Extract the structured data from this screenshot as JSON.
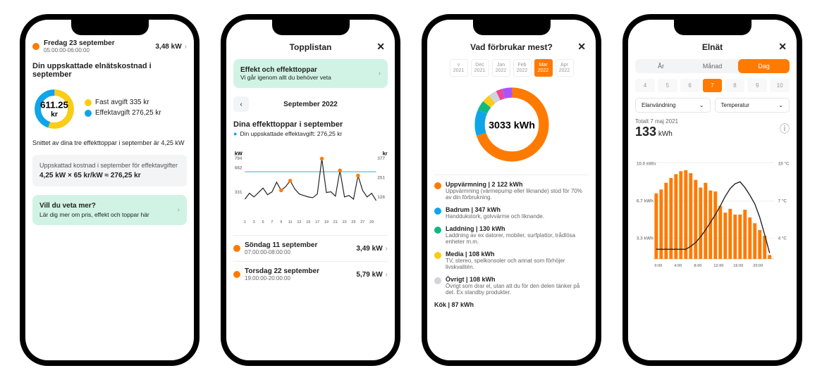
{
  "phone1": {
    "header_title": "Fredag 23 september",
    "header_time": "05:00:00-06:00:00",
    "header_value": "3,48 kW",
    "cost_title": "Din uppskattade elnätskostnad i september",
    "donut_value": "611.25",
    "donut_unit": "kr",
    "cost_items": [
      {
        "dot": "#facc15",
        "text": "Fast avgift 335 kr"
      },
      {
        "dot": "#0ea5e9",
        "text": "Effektavgift 276,25 kr"
      }
    ],
    "avg_text": "Snittet av dina tre effekttoppar i september är 4,25 kW",
    "calc_title": "Uppskattad kostnad i september för effektavgifter",
    "calc_line": "4,25 kW × 65 kr/kW ≈ 276,25 kr",
    "more_title": "Vill du veta mer?",
    "more_sub": "Lär dig mer om pris, effekt och toppar här"
  },
  "phone2": {
    "title": "Topplistan",
    "banner_title": "Effekt och effekttoppar",
    "banner_sub": "Vi går igenom allt du behöver veta",
    "month_label": "September 2022",
    "section_title": "Dina effekttoppar i september",
    "section_sub": "Din uppskattade effektavgift: 276,25 kr",
    "axis_kw": "kW",
    "axis_kr": "kr",
    "peaks": [
      {
        "title": "Söndag 11 september",
        "time": "07:00:00-08:00:00",
        "value": "3,49 kW"
      },
      {
        "title": "Torsdag 22 september",
        "time": "19:00:00-20:00:00",
        "value": "5,79 kW"
      }
    ]
  },
  "phone3": {
    "title": "Vad förbrukar mest?",
    "months": [
      {
        "m": "v",
        "y": "2021",
        "active": false
      },
      {
        "m": "Dec",
        "y": "2021",
        "active": false
      },
      {
        "m": "Jan",
        "y": "2022",
        "active": false
      },
      {
        "m": "Feb",
        "y": "2022",
        "active": false
      },
      {
        "m": "Mar",
        "y": "2022",
        "active": true
      },
      {
        "m": "Apr",
        "y": "2022",
        "active": false
      }
    ],
    "total": "3033 kWh",
    "categories": [
      {
        "dot": "#ff7a00",
        "title": "Uppvärmning | 2 122 kWh",
        "desc": "Uppvärmning (värmepump eller liknande) stod för 70% av din förbrukning."
      },
      {
        "dot": "#0ea5e9",
        "title": "Badrum | 347 kWh",
        "desc": "Handdukstork, golvvärme och liknande."
      },
      {
        "dot": "#10b981",
        "title": "Laddning | 130 kWh",
        "desc": "Laddning av ex datorer, mobiler, surfplattor, trådlösa enheter  m.m."
      },
      {
        "dot": "#facc15",
        "title": "Media | 108 kWh",
        "desc": "TV, stereo, spelkonsoler och annat som förhöjer livskvalitén."
      },
      {
        "dot": "#d1d5db",
        "title": "Övrigt | 108 kWh",
        "desc": "Övrigt som drar el, utan att du för den delen tänker på det. Ex standby produkter."
      }
    ],
    "extra": "Kök | 87 kWh"
  },
  "phone4": {
    "title": "Elnät",
    "segs": [
      {
        "label": "År",
        "active": false
      },
      {
        "label": "Månad",
        "active": false
      },
      {
        "label": "Dag",
        "active": true
      }
    ],
    "days": [
      "4",
      "5",
      "6",
      "7",
      "8",
      "9",
      "10"
    ],
    "active_day": "7",
    "select1": "Elanvändning",
    "select2": "Temperatur",
    "date_label": "Totalt 7 maj 2021",
    "big_value": "133",
    "big_unit": "kWh",
    "y_left_top": "10.0 kWh",
    "y_left_mid": "6.7 kWh",
    "y_left_low": "3.3 kWh",
    "y_right_top": "10 °C",
    "y_right_mid": "7 °C",
    "y_right_low": "4 °C"
  },
  "chart_data": [
    {
      "id": "phone2_line",
      "type": "line",
      "x": [
        1,
        2,
        3,
        4,
        5,
        6,
        7,
        8,
        9,
        10,
        11,
        12,
        13,
        14,
        15,
        16,
        17,
        18,
        19,
        20,
        21,
        22,
        23,
        24,
        25,
        26,
        27,
        28,
        29,
        30
      ],
      "values": [
        230,
        310,
        260,
        320,
        380,
        290,
        330,
        460,
        350,
        400,
        480,
        370,
        300,
        280,
        260,
        250,
        300,
        780,
        320,
        330,
        270,
        620,
        260,
        280,
        230,
        550,
        350,
        260,
        310,
        210
      ],
      "highlight_x": [
        9,
        11,
        18,
        22,
        26
      ],
      "left_axis": {
        "label": "kW",
        "ticks": [
          331,
          662,
          794
        ]
      },
      "right_axis": {
        "label": "kr",
        "ticks": [
          126,
          251,
          377
        ]
      },
      "x_ticks": [
        1,
        3,
        5,
        7,
        9,
        11,
        13,
        15,
        17,
        19,
        21,
        23,
        25,
        27,
        29
      ],
      "ref_line_y": 662
    },
    {
      "id": "phone3_donut",
      "type": "pie",
      "series": [
        {
          "name": "Uppvärmning",
          "value": 2122,
          "color": "#ff7a00"
        },
        {
          "name": "Badrum",
          "value": 347,
          "color": "#0ea5e9"
        },
        {
          "name": "Laddning",
          "value": 130,
          "color": "#10b981"
        },
        {
          "name": "Media",
          "value": 108,
          "color": "#facc15"
        },
        {
          "name": "Övrigt",
          "value": 108,
          "color": "#d1d5db"
        },
        {
          "name": "Kök",
          "value": 87,
          "color": "#ec4899"
        },
        {
          "name": "Other",
          "value": 131,
          "color": "#a855f7"
        }
      ],
      "total_label": "3033 kWh"
    },
    {
      "id": "phone4_combo",
      "type": "bar",
      "categories": [
        "0:00",
        "1:00",
        "2:00",
        "3:00",
        "4:00",
        "5:00",
        "6:00",
        "7:00",
        "8:00",
        "9:00",
        "10:00",
        "11:00",
        "12:00",
        "13:00",
        "14:00",
        "15:00",
        "16:00",
        "17:00",
        "18:00",
        "19:00",
        "20:00",
        "21:00",
        "22:00",
        "23:00"
      ],
      "series": [
        {
          "name": "Elanvändning",
          "type": "bar",
          "color": "#ff7a00",
          "values": [
            6.8,
            7.2,
            7.9,
            8.4,
            8.8,
            9.1,
            9.2,
            8.9,
            8.2,
            7.4,
            7.9,
            7.1,
            7.0,
            5.5,
            4.8,
            5.2,
            4.6,
            4.6,
            5.1,
            4.3,
            3.7,
            3.0,
            2.4,
            0.4
          ]
        },
        {
          "name": "Temperatur",
          "type": "line",
          "color": "#222",
          "values": [
            1,
            1,
            1,
            1,
            1,
            1,
            1,
            1.3,
            1.7,
            2.3,
            3.0,
            3.8,
            4.6,
            5.5,
            6.5,
            7.3,
            7.8,
            8.0,
            7.4,
            6.6,
            5.7,
            4.3,
            2.5,
            0.6
          ]
        }
      ],
      "x_ticks": [
        "0:00",
        "4:00",
        "8:00",
        "12:00",
        "16:00",
        "20:00"
      ],
      "y_left": {
        "label": "kWh",
        "ticks": [
          3.3,
          6.7,
          10.0
        ]
      },
      "y_right": {
        "label": "°C",
        "ticks": [
          4,
          7,
          10
        ]
      }
    },
    {
      "id": "phone1_donut",
      "type": "pie",
      "series": [
        {
          "name": "Fast avgift",
          "value": 335,
          "color": "#facc15"
        },
        {
          "name": "Effektavgift",
          "value": 276.25,
          "color": "#0ea5e9"
        }
      ],
      "total_label": "611.25 kr"
    }
  ]
}
